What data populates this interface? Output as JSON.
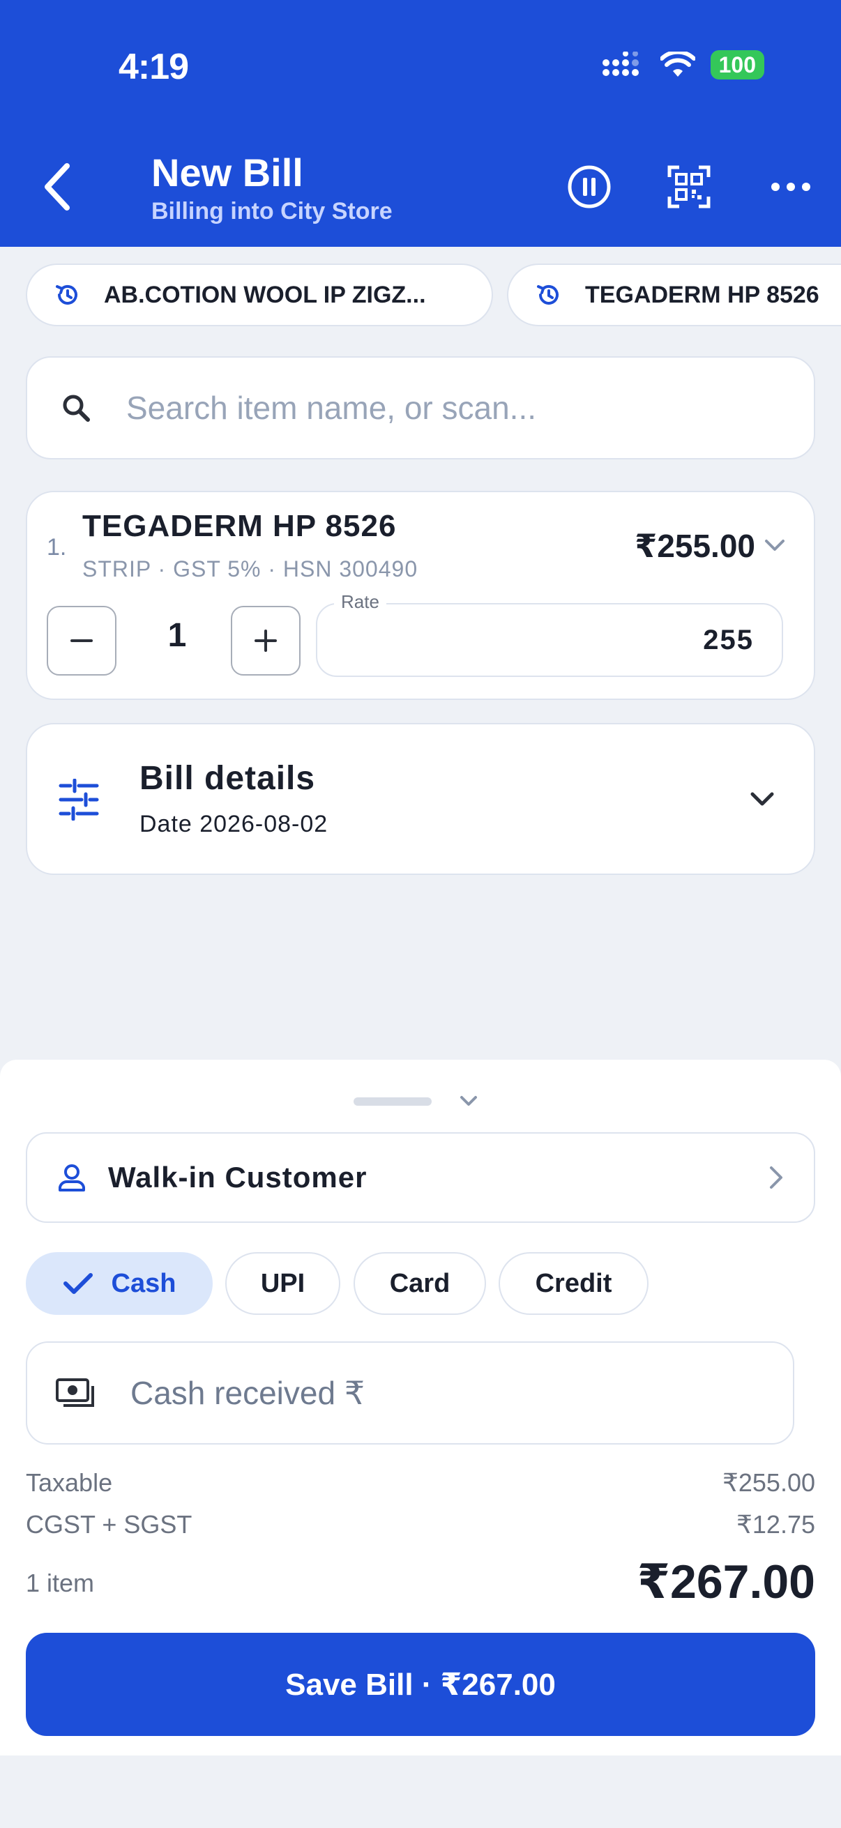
{
  "status_bar": {
    "time": "4:19",
    "battery": "100"
  },
  "header": {
    "title": "New Bill",
    "subtitle": "Billing into City Store"
  },
  "recent_items": [
    {
      "label": "AB.COTION WOOL IP ZIGZ..."
    },
    {
      "label": "TEGADERM HP 8526"
    }
  ],
  "search": {
    "placeholder": "Search item name, or scan..."
  },
  "items": [
    {
      "index": "1.",
      "name": "TEGADERM HP 8526",
      "meta": "STRIP · GST 5% · HSN 300490",
      "amount": "₹255.00",
      "qty": "1",
      "rate_label": "Rate",
      "rate": "255"
    }
  ],
  "bill_details": {
    "title": "Bill details",
    "date": "Date 2026-08-02"
  },
  "customer": {
    "label": "Walk-in Customer"
  },
  "payment_modes": [
    {
      "label": "Cash",
      "selected": true
    },
    {
      "label": "UPI",
      "selected": false
    },
    {
      "label": "Card",
      "selected": false
    },
    {
      "label": "Credit",
      "selected": false
    }
  ],
  "cash_input": {
    "placeholder": "Cash received ₹"
  },
  "summary": {
    "taxable_label": "Taxable",
    "taxable_value": "₹255.00",
    "tax_label": "CGST + SGST",
    "tax_value": "₹12.75",
    "count_label": "1 item",
    "total": "₹267.00"
  },
  "save_button": {
    "label": "Save Bill · ₹267.00"
  },
  "colors": {
    "primary": "#1d4ed8",
    "background": "#eef1f6",
    "selected_chip": "#dbe7fb",
    "battery": "#34c759"
  }
}
